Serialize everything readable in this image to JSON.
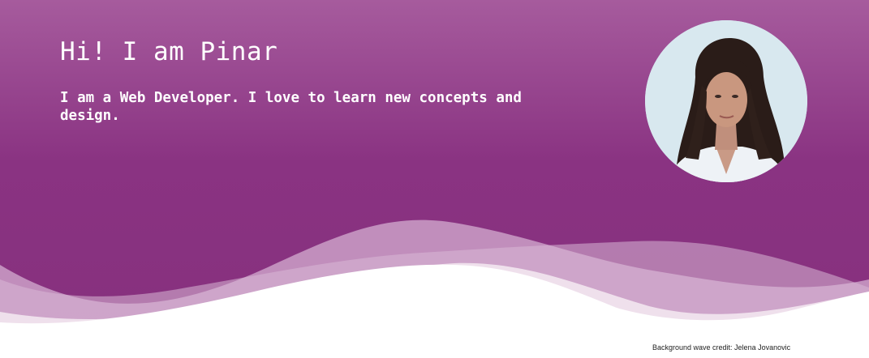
{
  "hero": {
    "title": "Hi! I am Pinar",
    "tagline": "I am a Web Developer. I love to learn new concepts and design.",
    "colors": {
      "gradient_top": "#a65b9d",
      "gradient_bottom": "#88307e",
      "wave_mid": "#c7a0c8",
      "wave_light": "#eddde9",
      "page_bg": "#ffffff"
    }
  },
  "avatar": {
    "alt": "Pinar"
  },
  "footer": {
    "credit": "Background wave credit: Jelena Jovanovic"
  }
}
